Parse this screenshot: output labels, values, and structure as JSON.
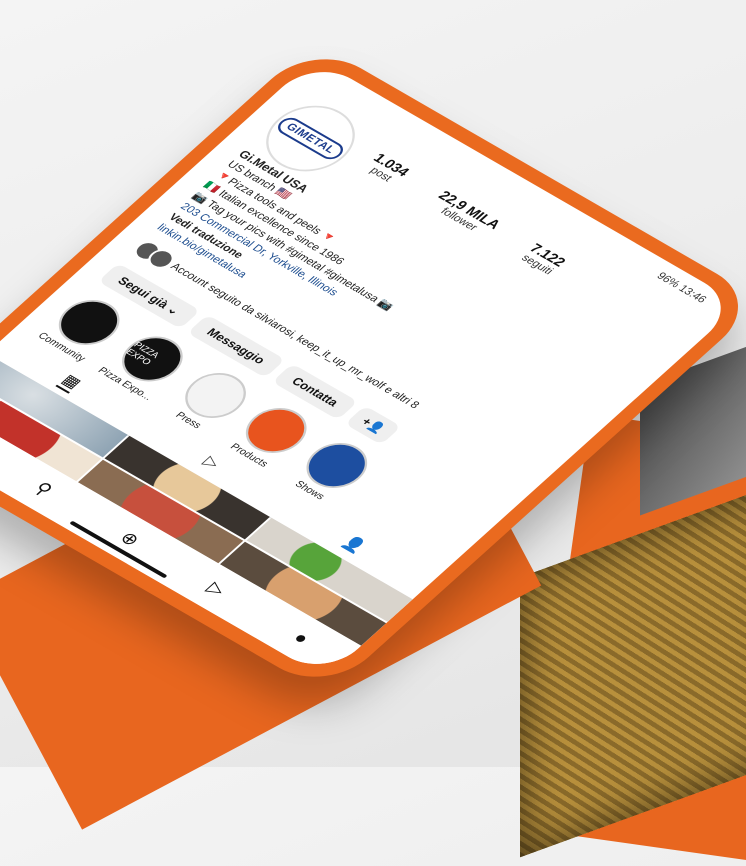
{
  "status_bar": {
    "text": "96% 13:46"
  },
  "profile": {
    "logo_text": "GIMETAL",
    "stats": [
      {
        "value": "1.034",
        "label": "post"
      },
      {
        "value": "22,9 MILA",
        "label": "follower"
      },
      {
        "value": "7.122",
        "label": "seguiti"
      }
    ],
    "name": "Gi.Metal USA",
    "bio_lines": [
      "US branch 🇺🇸",
      "🔻Pizza tools and peels 🔻",
      "🇮🇹 Italian excellence since 1986",
      "📷 Tag your pics with #gimetal #gimetalusa 📷",
      "203 Commercial Dr, Yorkville, Illinois"
    ],
    "translate": "Vedi traduzione",
    "link": "linkin.bio/gimetalusa",
    "followed_by": "Account seguito da silviarosi, keep_it_up_mr_wolf e altri 8"
  },
  "buttons": {
    "follow": "Segui già ⌄",
    "message": "Messaggio",
    "contact": "Contatta",
    "suggest": "+👤"
  },
  "highlights": [
    {
      "label": "Community",
      "inner": "",
      "color": "#111111"
    },
    {
      "label": "Pizza Expo...",
      "inner": "PIZZA EXPO",
      "color": "#111111"
    },
    {
      "label": "Press",
      "inner": "",
      "color": "#ffffff"
    },
    {
      "label": "Products",
      "inner": "",
      "color": "#e8541e"
    },
    {
      "label": "Shows",
      "inner": "",
      "color": "#1d4ea0"
    }
  ],
  "tabs": [
    "▦",
    "▷",
    "👤"
  ],
  "nav": [
    "⌂",
    "⚲",
    "⊕",
    "▷",
    "●"
  ],
  "colors": {
    "accent": "#e8661f",
    "link": "#1d4d8f"
  }
}
